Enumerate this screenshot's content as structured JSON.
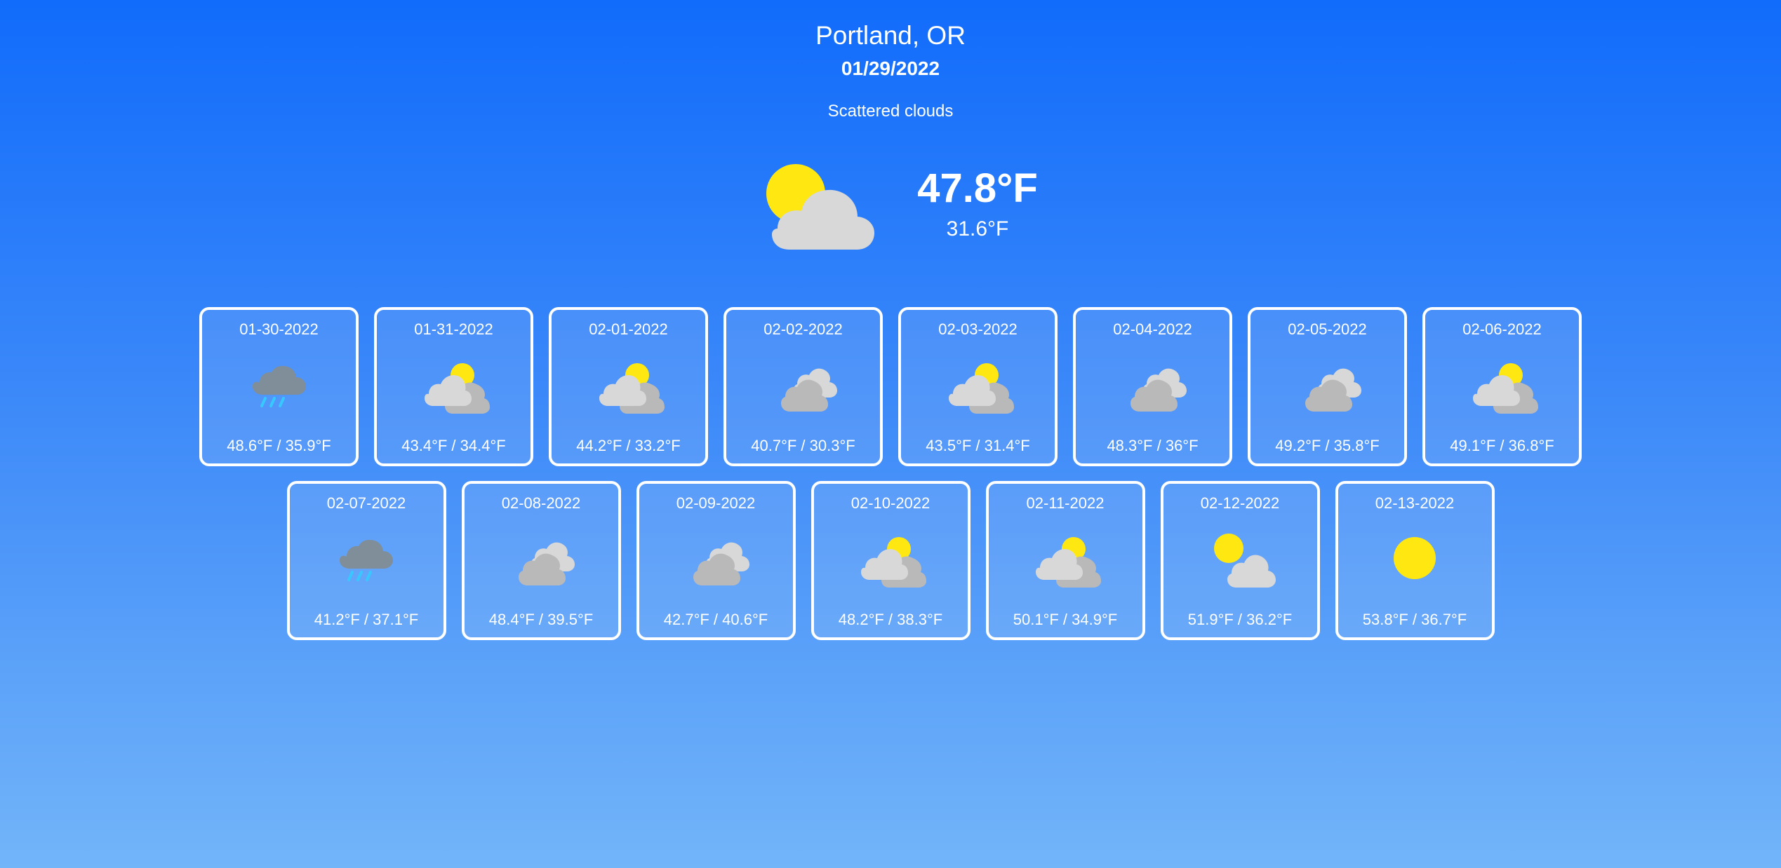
{
  "location": {
    "city": "Portland, OR",
    "date": "01/29/2022",
    "description": "Scattered clouds"
  },
  "current": {
    "icon": "partly-cloudy-icon",
    "high": "47.8°F",
    "low": "31.6°F"
  },
  "forecast": [
    {
      "date": "01-30-2022",
      "temps": "48.6°F / 35.9°F",
      "icon": "rain-icon"
    },
    {
      "date": "01-31-2022",
      "temps": "43.4°F / 34.4°F",
      "icon": "partly-cloudy-icon"
    },
    {
      "date": "02-01-2022",
      "temps": "44.2°F / 33.2°F",
      "icon": "partly-cloudy-icon"
    },
    {
      "date": "02-02-2022",
      "temps": "40.7°F / 30.3°F",
      "icon": "cloudy-icon"
    },
    {
      "date": "02-03-2022",
      "temps": "43.5°F / 31.4°F",
      "icon": "partly-cloudy-icon"
    },
    {
      "date": "02-04-2022",
      "temps": "48.3°F / 36°F",
      "icon": "cloudy-icon"
    },
    {
      "date": "02-05-2022",
      "temps": "49.2°F / 35.8°F",
      "icon": "cloudy-icon"
    },
    {
      "date": "02-06-2022",
      "temps": "49.1°F / 36.8°F",
      "icon": "partly-cloudy-icon"
    },
    {
      "date": "02-07-2022",
      "temps": "41.2°F / 37.1°F",
      "icon": "rain-icon"
    },
    {
      "date": "02-08-2022",
      "temps": "48.4°F / 39.5°F",
      "icon": "cloudy-icon"
    },
    {
      "date": "02-09-2022",
      "temps": "42.7°F / 40.6°F",
      "icon": "cloudy-icon"
    },
    {
      "date": "02-10-2022",
      "temps": "48.2°F / 38.3°F",
      "icon": "partly-cloudy-icon"
    },
    {
      "date": "02-11-2022",
      "temps": "50.1°F / 34.9°F",
      "icon": "partly-cloudy-icon"
    },
    {
      "date": "02-12-2022",
      "temps": "51.9°F / 36.2°F",
      "icon": "sun-cloud-icon"
    },
    {
      "date": "02-13-2022",
      "temps": "53.8°F / 36.7°F",
      "icon": "sun-icon"
    }
  ],
  "colors": {
    "sun": "#ffe812",
    "cloud_light": "#d8d8d8",
    "cloud_dark": "#b9b9b9",
    "rain_cloud": "#7f8e98",
    "rain_drop": "#38c8ff",
    "card_border": "#ffffff"
  }
}
